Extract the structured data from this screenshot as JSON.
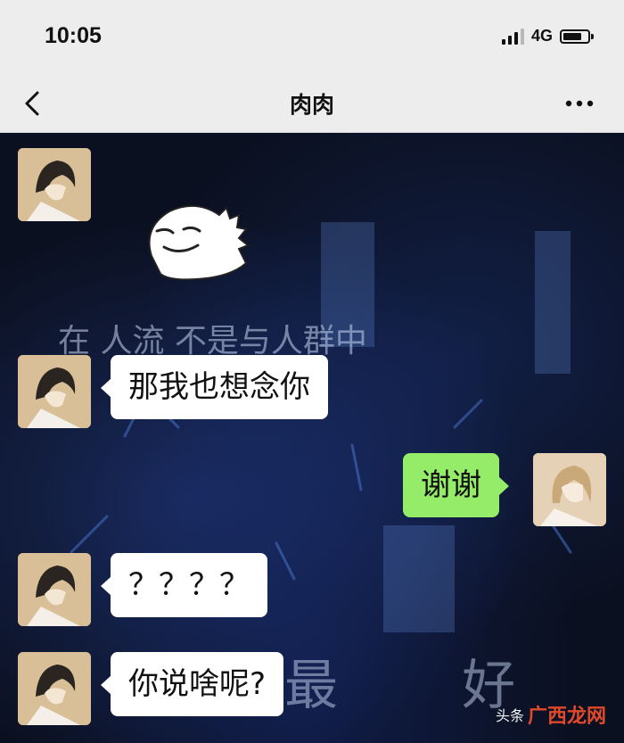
{
  "status_bar": {
    "time": "10:05",
    "network": "4G",
    "battery_level": 0.75
  },
  "nav": {
    "title": "肉肉",
    "back_icon": "chevron-left-icon",
    "more_icon": "more-dots-icon"
  },
  "messages": [
    {
      "side": "left",
      "type": "sticker",
      "sticker": "smiling-dinosaur-sticker"
    },
    {
      "side": "left",
      "type": "text",
      "text": "那我也想念你"
    },
    {
      "side": "right",
      "type": "text",
      "text": "谢谢"
    },
    {
      "side": "left",
      "type": "text",
      "text": "？？？？"
    },
    {
      "side": "left",
      "type": "text",
      "text": "你说啥呢?"
    }
  ],
  "background_text": {
    "line1": "在 人流 不是与人群中",
    "line2": "你 最 好"
  },
  "watermark": {
    "prefix": "头条",
    "brand": "广西龙网"
  },
  "colors": {
    "nav_bg": "#ededed",
    "sent_bubble": "#95ec69",
    "received_bubble": "#ffffff",
    "chat_bg": "#0b1020"
  }
}
